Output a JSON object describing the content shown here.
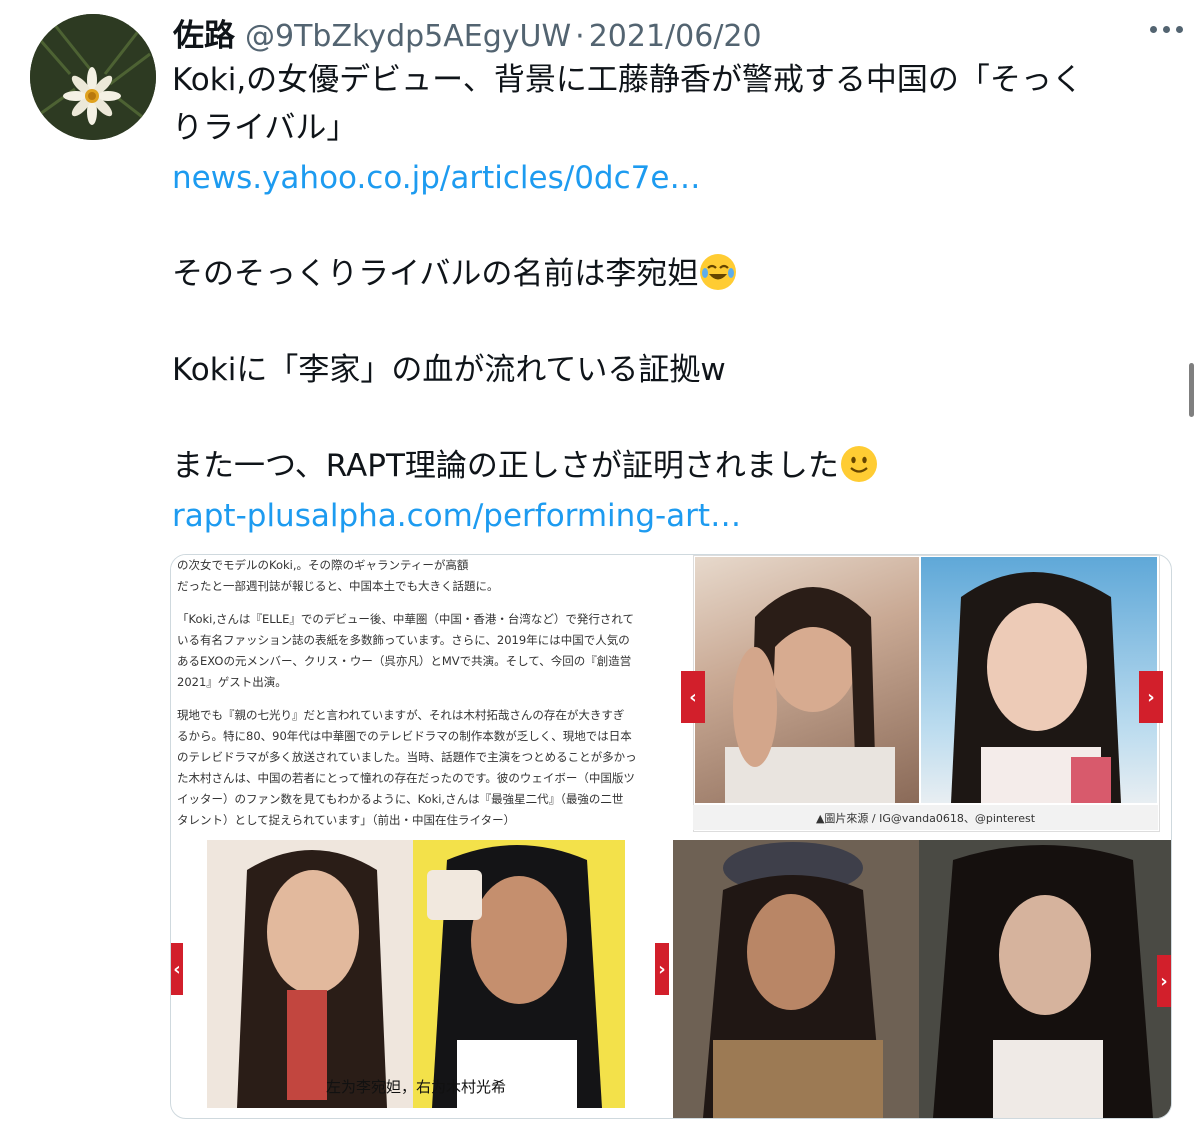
{
  "author": {
    "display_name": "佐路",
    "handle": "@9TbZkydp5AEgyUW",
    "separator": "·",
    "date": "2021/06/20"
  },
  "tweet": {
    "line1": "Koki,の女優デビュー、背景に工藤静香が警戒する中国の「そっく",
    "line2": "りライバル」",
    "link1": "news.yahoo.co.jp/articles/0dc7e…",
    "line3": "そのそっくりライバルの名前は李宛妲",
    "line4": "Kokiに「李家」の血が流れている証拠w",
    "line5": "また一つ、RAPT理論の正しさが証明されました",
    "link2": "rapt-plusalpha.com/performing-art…"
  },
  "media": {
    "article_lines_1": [
      "の次女でモデルのKoki,。その際のギャランティーが高額",
      "だったと一部週刊誌が報じると、中国本土でも大きく話題に。"
    ],
    "article_lines_2": [
      "「Koki,さんは『ELLE』でのデビュー後、中華圏（中国・香港・台湾など）で発行されて",
      "いる有名ファッション誌の表紙を多数飾っています。さらに、2019年には中国で人気の",
      "あるEXOの元メンバー、クリス・ウー（呉亦凡）とMVで共演。そして、今回の『創造営",
      "2021』ゲスト出演。"
    ],
    "article_lines_3": [
      "現地でも『親の七光り』だと言われていますが、それは木村拓哉さんの存在が大きすぎ",
      "るから。特に80、90年代は中華圏でのテレビドラマの制作本数が乏しく、現地では日本",
      "のテレビドラマが多く放送されていました。当時、話題作で主演をつとめることが多かっ",
      "た木村さんは、中国の若者にとって憧れの存在だったのです。彼のウェイボー（中国版ツ",
      "イッター）のファン数を見てもわかるように、Koki,さんは『最強星二代』（最強の二世",
      "タレント）として捉えられています」（前出・中国在住ライター）"
    ],
    "photo_caption": "▲圖片來源 / IG@vanda0618、@pinterest",
    "lower_left_caption": "左为李宛妲，右为木村光希"
  },
  "icons": {
    "more": "more-horizontal-icon",
    "emoji_tears": "face-with-tears-of-joy-icon",
    "emoji_smile": "slightly-smiling-face-icon",
    "arrow_left": "chevron-left-icon",
    "arrow_right": "chevron-right-icon"
  },
  "colors": {
    "link": "#1d9bf0",
    "secondary_text": "#536471",
    "slider_arrow": "#d21f2b"
  }
}
